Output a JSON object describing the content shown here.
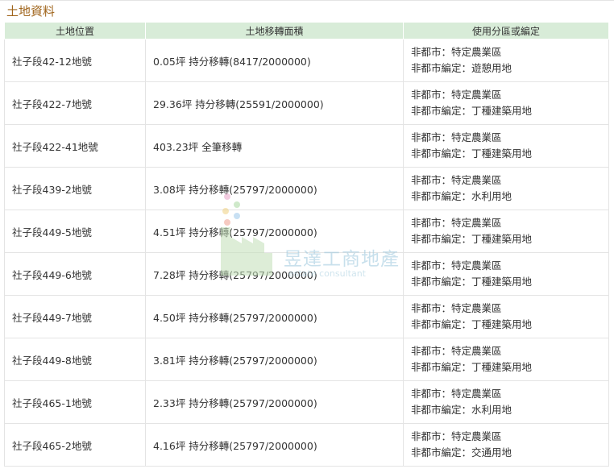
{
  "section": {
    "title": "土地資料"
  },
  "table": {
    "headers": [
      "土地位置",
      "土地移轉面積",
      "使用分區或編定"
    ],
    "rows": [
      {
        "location": "社子段42-12地號",
        "area": "0.05坪 持分移轉(8417/2000000)",
        "zone1": "非都市：特定農業區",
        "zone2": "非都市編定：遊憩用地"
      },
      {
        "location": "社子段422-7地號",
        "area": "29.36坪 持分移轉(25591/2000000)",
        "zone1": "非都市：特定農業區",
        "zone2": "非都市編定：丁種建築用地"
      },
      {
        "location": "社子段422-41地號",
        "area": "403.23坪 全筆移轉",
        "zone1": "非都市：特定農業區",
        "zone2": "非都市編定：丁種建築用地"
      },
      {
        "location": "社子段439-2地號",
        "area": "3.08坪 持分移轉(25797/2000000)",
        "zone1": "非都市：特定農業區",
        "zone2": "非都市編定：水利用地"
      },
      {
        "location": "社子段449-5地號",
        "area": "4.51坪 持分移轉(25797/2000000)",
        "zone1": "非都市：特定農業區",
        "zone2": "非都市編定：丁種建築用地"
      },
      {
        "location": "社子段449-6地號",
        "area": "7.28坪 持分移轉(25797/2000000)",
        "zone1": "非都市：特定農業區",
        "zone2": "非都市編定：丁種建築用地"
      },
      {
        "location": "社子段449-7地號",
        "area": "4.50坪 持分移轉(25797/2000000)",
        "zone1": "非都市：特定農業區",
        "zone2": "非都市編定：丁種建築用地"
      },
      {
        "location": "社子段449-8地號",
        "area": "3.81坪 持分移轉(25797/2000000)",
        "zone1": "非都市：特定農業區",
        "zone2": "非都市編定：丁種建築用地"
      },
      {
        "location": "社子段465-1地號",
        "area": "2.33坪 持分移轉(25797/2000000)",
        "zone1": "非都市：特定農業區",
        "zone2": "非都市編定：水利用地"
      },
      {
        "location": "社子段465-2地號",
        "area": "4.16坪 持分移轉(25797/2000000)",
        "zone1": "非都市：特定農業區",
        "zone2": "非都市編定：交通用地"
      }
    ]
  },
  "watermark": {
    "name": "昱達工商地產",
    "sub": "estate consultant"
  },
  "colors": {
    "header_bg": "#d8ecd8",
    "title": "#a0651c",
    "border": "#e4e4e4"
  }
}
